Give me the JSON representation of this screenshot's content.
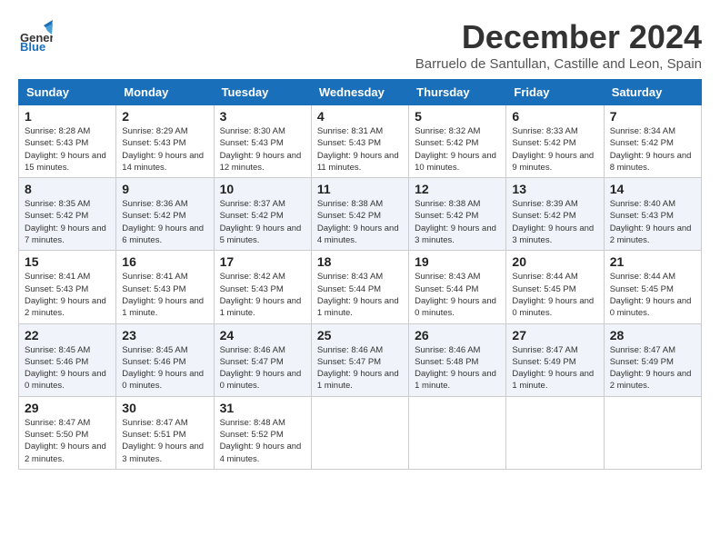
{
  "logo": {
    "general": "General",
    "blue": "Blue"
  },
  "title": "December 2024",
  "location": "Barruelo de Santullan, Castille and Leon, Spain",
  "days_of_week": [
    "Sunday",
    "Monday",
    "Tuesday",
    "Wednesday",
    "Thursday",
    "Friday",
    "Saturday"
  ],
  "weeks": [
    [
      {
        "day": "1",
        "sunrise": "8:28 AM",
        "sunset": "5:43 PM",
        "daylight": "9 hours and 15 minutes."
      },
      {
        "day": "2",
        "sunrise": "8:29 AM",
        "sunset": "5:43 PM",
        "daylight": "9 hours and 14 minutes."
      },
      {
        "day": "3",
        "sunrise": "8:30 AM",
        "sunset": "5:43 PM",
        "daylight": "9 hours and 12 minutes."
      },
      {
        "day": "4",
        "sunrise": "8:31 AM",
        "sunset": "5:43 PM",
        "daylight": "9 hours and 11 minutes."
      },
      {
        "day": "5",
        "sunrise": "8:32 AM",
        "sunset": "5:42 PM",
        "daylight": "9 hours and 10 minutes."
      },
      {
        "day": "6",
        "sunrise": "8:33 AM",
        "sunset": "5:42 PM",
        "daylight": "9 hours and 9 minutes."
      },
      {
        "day": "7",
        "sunrise": "8:34 AM",
        "sunset": "5:42 PM",
        "daylight": "9 hours and 8 minutes."
      }
    ],
    [
      {
        "day": "8",
        "sunrise": "8:35 AM",
        "sunset": "5:42 PM",
        "daylight": "9 hours and 7 minutes."
      },
      {
        "day": "9",
        "sunrise": "8:36 AM",
        "sunset": "5:42 PM",
        "daylight": "9 hours and 6 minutes."
      },
      {
        "day": "10",
        "sunrise": "8:37 AM",
        "sunset": "5:42 PM",
        "daylight": "9 hours and 5 minutes."
      },
      {
        "day": "11",
        "sunrise": "8:38 AM",
        "sunset": "5:42 PM",
        "daylight": "9 hours and 4 minutes."
      },
      {
        "day": "12",
        "sunrise": "8:38 AM",
        "sunset": "5:42 PM",
        "daylight": "9 hours and 3 minutes."
      },
      {
        "day": "13",
        "sunrise": "8:39 AM",
        "sunset": "5:42 PM",
        "daylight": "9 hours and 3 minutes."
      },
      {
        "day": "14",
        "sunrise": "8:40 AM",
        "sunset": "5:43 PM",
        "daylight": "9 hours and 2 minutes."
      }
    ],
    [
      {
        "day": "15",
        "sunrise": "8:41 AM",
        "sunset": "5:43 PM",
        "daylight": "9 hours and 2 minutes."
      },
      {
        "day": "16",
        "sunrise": "8:41 AM",
        "sunset": "5:43 PM",
        "daylight": "9 hours and 1 minute."
      },
      {
        "day": "17",
        "sunrise": "8:42 AM",
        "sunset": "5:43 PM",
        "daylight": "9 hours and 1 minute."
      },
      {
        "day": "18",
        "sunrise": "8:43 AM",
        "sunset": "5:44 PM",
        "daylight": "9 hours and 1 minute."
      },
      {
        "day": "19",
        "sunrise": "8:43 AM",
        "sunset": "5:44 PM",
        "daylight": "9 hours and 0 minutes."
      },
      {
        "day": "20",
        "sunrise": "8:44 AM",
        "sunset": "5:45 PM",
        "daylight": "9 hours and 0 minutes."
      },
      {
        "day": "21",
        "sunrise": "8:44 AM",
        "sunset": "5:45 PM",
        "daylight": "9 hours and 0 minutes."
      }
    ],
    [
      {
        "day": "22",
        "sunrise": "8:45 AM",
        "sunset": "5:46 PM",
        "daylight": "9 hours and 0 minutes."
      },
      {
        "day": "23",
        "sunrise": "8:45 AM",
        "sunset": "5:46 PM",
        "daylight": "9 hours and 0 minutes."
      },
      {
        "day": "24",
        "sunrise": "8:46 AM",
        "sunset": "5:47 PM",
        "daylight": "9 hours and 0 minutes."
      },
      {
        "day": "25",
        "sunrise": "8:46 AM",
        "sunset": "5:47 PM",
        "daylight": "9 hours and 1 minute."
      },
      {
        "day": "26",
        "sunrise": "8:46 AM",
        "sunset": "5:48 PM",
        "daylight": "9 hours and 1 minute."
      },
      {
        "day": "27",
        "sunrise": "8:47 AM",
        "sunset": "5:49 PM",
        "daylight": "9 hours and 1 minute."
      },
      {
        "day": "28",
        "sunrise": "8:47 AM",
        "sunset": "5:49 PM",
        "daylight": "9 hours and 2 minutes."
      }
    ],
    [
      {
        "day": "29",
        "sunrise": "8:47 AM",
        "sunset": "5:50 PM",
        "daylight": "9 hours and 2 minutes."
      },
      {
        "day": "30",
        "sunrise": "8:47 AM",
        "sunset": "5:51 PM",
        "daylight": "9 hours and 3 minutes."
      },
      {
        "day": "31",
        "sunrise": "8:48 AM",
        "sunset": "5:52 PM",
        "daylight": "9 hours and 4 minutes."
      },
      null,
      null,
      null,
      null
    ]
  ],
  "labels": {
    "sunrise": "Sunrise:",
    "sunset": "Sunset:",
    "daylight": "Daylight:"
  }
}
